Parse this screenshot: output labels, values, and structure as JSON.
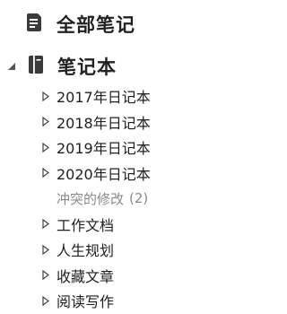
{
  "sidebar": {
    "all_notes": {
      "label": "全部笔记",
      "icon": "note-icon"
    },
    "notebooks": {
      "label": "笔记本",
      "icon": "notebook-icon",
      "expanded": true,
      "items": [
        {
          "label": "2017年日记本",
          "has_children": true
        },
        {
          "label": "2018年日记本",
          "has_children": true
        },
        {
          "label": "2019年日记本",
          "has_children": true
        },
        {
          "label": "2020年日记本",
          "has_children": true
        },
        {
          "label": "冲突的修改",
          "count": "(2)",
          "has_children": false,
          "muted": true
        },
        {
          "label": "工作文档",
          "has_children": true
        },
        {
          "label": "人生规划",
          "has_children": true
        },
        {
          "label": "收藏文章",
          "has_children": true
        },
        {
          "label": "阅读写作",
          "has_children": true
        }
      ]
    }
  }
}
